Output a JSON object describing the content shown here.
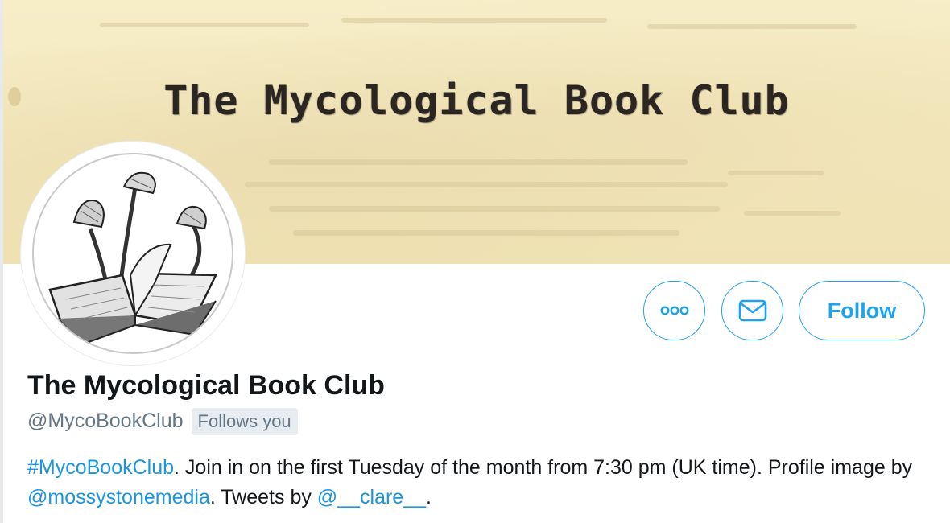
{
  "banner": {
    "title": "The Mycological Book Club",
    "background_color": "#f5ebc4"
  },
  "avatar": {
    "alt": "open book with mushrooms illustration"
  },
  "actions": {
    "more_icon": "more-horizontal-icon",
    "message_icon": "envelope-icon",
    "follow_label": "Follow",
    "accent_color": "#1da1f2"
  },
  "profile": {
    "display_name": "The Mycological Book Club",
    "handle": "@MycoBookClub",
    "follows_you": "Follows you"
  },
  "bio": {
    "hashtag": "#MycoBookClub",
    "text1": ". Join in on the first Tuesday of the month from 7:30 pm (UK time). Profile image by ",
    "mention1": "@mossystonemedia",
    "text2": ". Tweets by ",
    "mention2": "@__clare__",
    "text3": "."
  }
}
